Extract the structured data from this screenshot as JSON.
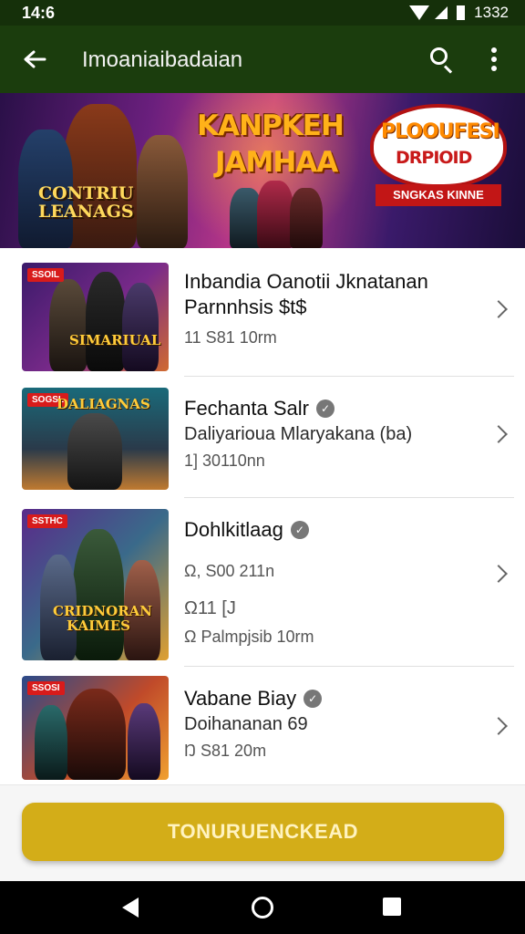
{
  "status_bar": {
    "time": "14:6",
    "right_text": "1332"
  },
  "app_bar": {
    "title": "Imoaniaibadaian"
  },
  "banner": {
    "title_line1": "KANPKEH",
    "title_line2": "JAMHAA",
    "left_title": "CONTRIU LEANAGS",
    "badge_line1": "PLOOUFESI",
    "badge_line2": "DRPIOID",
    "badge_ribbon": "SNGKAS KINNE"
  },
  "items": [
    {
      "tag": "SSOIL",
      "thumb_text": "SIMARIUAL",
      "title": "Inbandia Oanotii Jknatanan",
      "subtitle": "Parnnhsis $t$",
      "meta": "11 S81 10rm"
    },
    {
      "tag": "SOGSL",
      "thumb_text": "DALIAGNAS",
      "title": "Fechanta Salr",
      "subtitle": "Daliyarioua Mlaryakana (ba)",
      "meta": "1] 30110nn"
    },
    {
      "tag": "SSTHC",
      "thumb_text": "CRIDNORAN KAIMES",
      "title": "Dohlkitlaag",
      "meta_lines": [
        "Ω, S00 211n",
        "Ω11 [J",
        "Ω Palmpjsib 10rm"
      ]
    },
    {
      "tag": "SSOSI",
      "thumb_text": "",
      "title": "Vabane Biay",
      "subtitle": "Doihananan 69",
      "meta": "Ŋ S81 20m"
    }
  ],
  "cta": {
    "label": "TONURUENCKEAD"
  },
  "colors": {
    "app_bar": "#1b3d0d",
    "cta": "#d3ad18",
    "tag": "#d81b1b"
  }
}
